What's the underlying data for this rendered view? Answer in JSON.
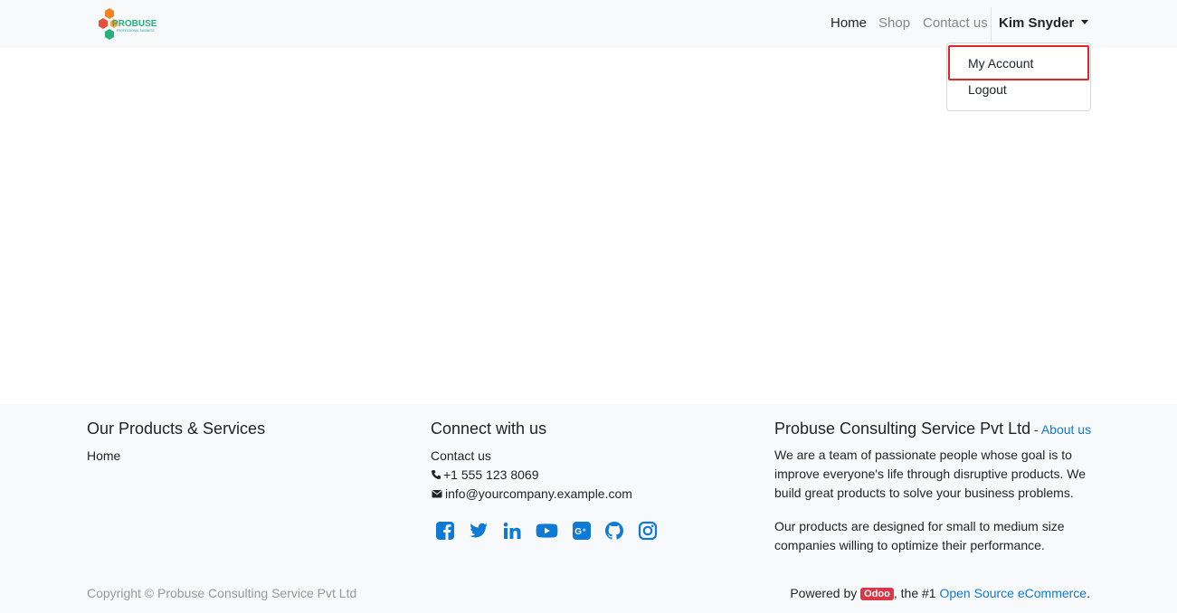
{
  "brand": {
    "name": "PROBUSE",
    "tagline": "PROFESSIONAL BUSINESS",
    "colors": {
      "orange": "#f58220",
      "red": "#e8503a",
      "green": "#27b07a",
      "teal": "#1aa3a3"
    }
  },
  "nav": {
    "home": "Home",
    "shop": "Shop",
    "contact": "Contact us",
    "user": "Kim Snyder"
  },
  "dropdown": {
    "items": [
      "My Account",
      "Logout"
    ],
    "highlight_color": "#e0262b"
  },
  "footer": {
    "products": {
      "title": "Our Products & Services",
      "links": [
        "Home"
      ]
    },
    "connect": {
      "title": "Connect with us",
      "contact_link": "Contact us",
      "phone": "+1 555 123 8069",
      "email": "info@yourcompany.example.com",
      "social_icons": [
        "facebook-icon",
        "twitter-icon",
        "linkedin-icon",
        "youtube-icon",
        "google-plus-icon",
        "github-icon",
        "instagram-icon"
      ]
    },
    "about": {
      "title": "Probuse Consulting Service Pvt Ltd",
      "title_sep": " - ",
      "about_link": "About us",
      "para1": "We are a team of passionate people whose goal is to improve everyone's life through disruptive products. We build great products to solve your business problems.",
      "para2": "Our products are designed for small to medium size companies willing to optimize their performance."
    },
    "copyright": "Copyright © Probuse Consulting Service Pvt Ltd",
    "powered": {
      "prefix": "Powered by ",
      "badge": "Odoo",
      "middle": ", the #1 ",
      "link": "Open Source eCommerce",
      "suffix": "."
    },
    "link_color": "#0e7ad6"
  }
}
